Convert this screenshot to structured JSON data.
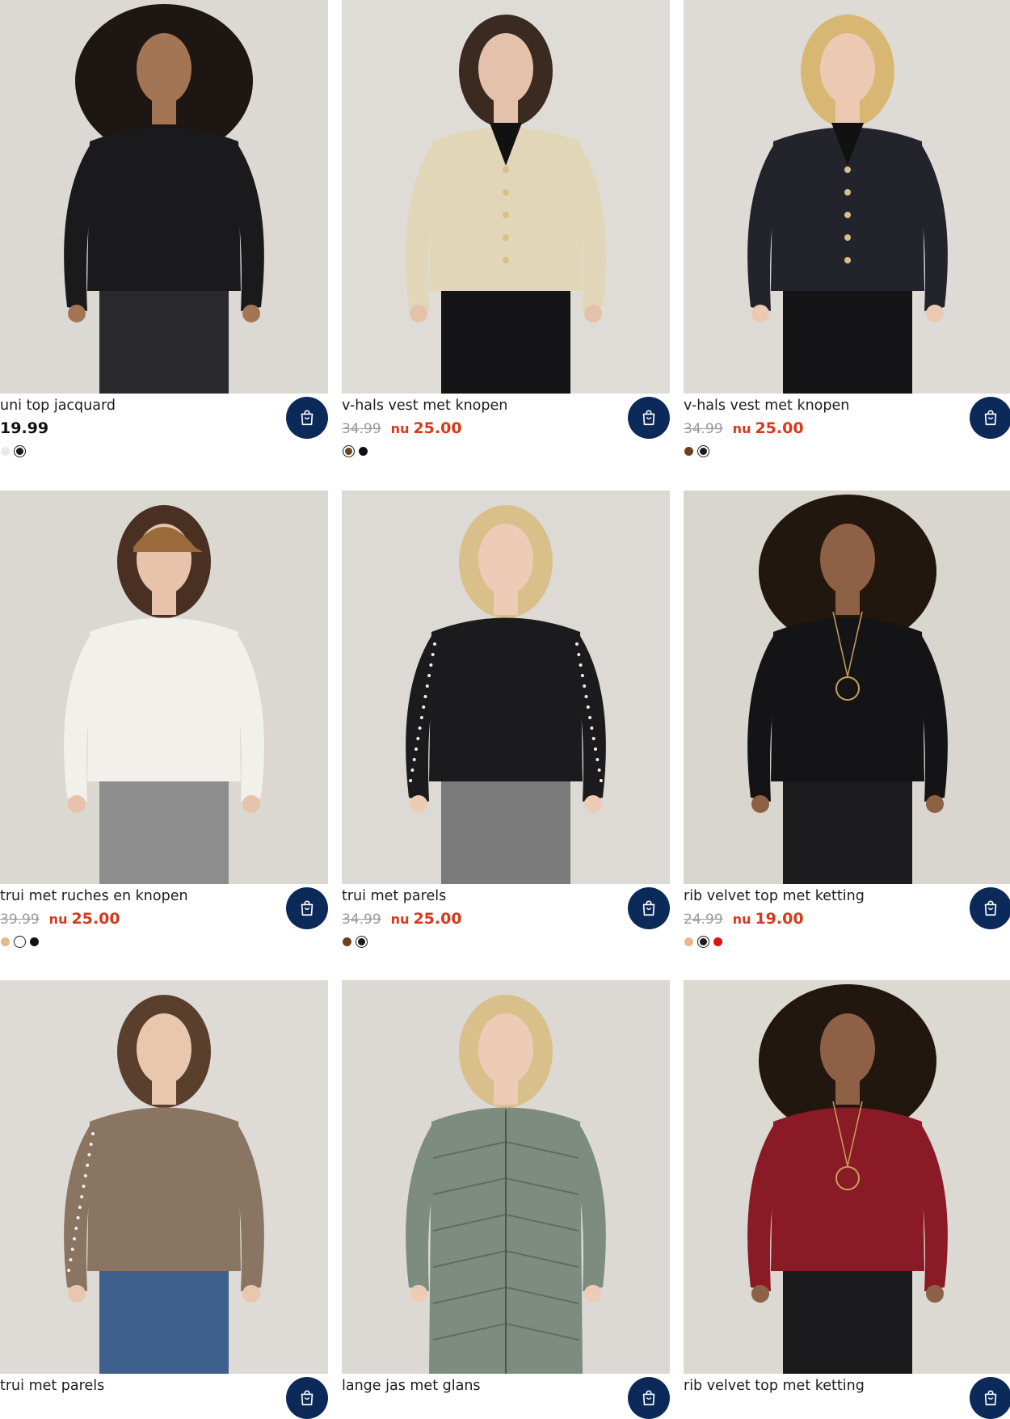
{
  "products": [
    {
      "name": "uni top jacquard",
      "price": "19.99",
      "old_price": "",
      "now_label": "",
      "new_price": "",
      "image": "model-in-black-top-photo",
      "bg": "#dcd9d4",
      "top": "#1a1a1c",
      "bottom": "#2a2a2e",
      "hair": "#1e1612",
      "skin": "#a47555",
      "swatches": [
        {
          "color": "#e8e8f0",
          "selected": false
        },
        {
          "color": "#1a1a1a",
          "selected": true
        }
      ]
    },
    {
      "name": "v-hals vest met knopen",
      "price": "",
      "old_price": "34.99",
      "now_label": "nu",
      "new_price": "25.00",
      "image": "model-in-beige-cardigan-photo",
      "bg": "#dfdcd7",
      "top": "#e2d6b9",
      "bottom": "#141416",
      "hair": "#3a2a20",
      "skin": "#e3c1aa",
      "swatches": [
        {
          "color": "#6b4020",
          "selected": true
        },
        {
          "color": "#111111",
          "selected": false
        }
      ]
    },
    {
      "name": "v-hals vest met knopen",
      "price": "",
      "old_price": "34.99",
      "now_label": "nu",
      "new_price": "25.00",
      "image": "model-in-black-cardigan-photo",
      "bg": "#dedbd6",
      "top": "#23232b",
      "bottom": "#141416",
      "hair": "#d8b772",
      "skin": "#ecc9b2",
      "swatches": [
        {
          "color": "#6b4020",
          "selected": false
        },
        {
          "color": "#1a1a1a",
          "selected": true
        }
      ]
    },
    {
      "name": "trui met ruches en knopen",
      "price": "",
      "old_price": "39.99",
      "now_label": "nu",
      "new_price": "25.00",
      "image": "model-in-white-ruffle-sweater-photo",
      "bg": "#dbd8d2",
      "top": "#f2f0ea",
      "bottom": "#8e8e8e",
      "hair": "#4a3022",
      "skin": "#e6c3aa",
      "swatches": [
        {
          "color": "#e6b88e",
          "selected": false
        },
        {
          "color": "#ffffff",
          "selected": true
        },
        {
          "color": "#111111",
          "selected": false
        }
      ]
    },
    {
      "name": "trui met parels",
      "price": "",
      "old_price": "34.99",
      "now_label": "nu",
      "new_price": "25.00",
      "image": "model-in-black-pearl-sweater-photo",
      "bg": "#dddad5",
      "top": "#1b1b1d",
      "bottom": "#7a7a7a",
      "hair": "#d9c08a",
      "skin": "#ecccb6",
      "swatches": [
        {
          "color": "#6b4020",
          "selected": false
        },
        {
          "color": "#1a1a1a",
          "selected": true
        }
      ]
    },
    {
      "name": "rib velvet top met ketting",
      "price": "",
      "old_price": "24.99",
      "now_label": "nu",
      "new_price": "19.00",
      "image": "model-in-black-velvet-top-photo",
      "bg": "#d9d5cf",
      "top": "#141416",
      "bottom": "#1c1c1e",
      "hair": "#22170f",
      "skin": "#8e6046",
      "swatches": [
        {
          "color": "#e6b88e",
          "selected": false
        },
        {
          "color": "#1a1a1a",
          "selected": true
        },
        {
          "color": "#e01010",
          "selected": false
        }
      ]
    },
    {
      "name": "trui met parels",
      "price": "",
      "old_price": "",
      "now_label": "",
      "new_price": "",
      "image": "model-in-brown-pearl-sweater-photo",
      "bg": "#dedbd6",
      "top": "#8a7462",
      "bottom": "#3f5f8c",
      "hair": "#5a3f2c",
      "skin": "#e8c7ae",
      "swatches": []
    },
    {
      "name": "lange jas met glans",
      "price": "",
      "old_price": "",
      "now_label": "",
      "new_price": "",
      "image": "model-in-green-puffer-coat-photo",
      "bg": "#dcd9d4",
      "top": "#7e8c80",
      "bottom": "#2b3a55",
      "hair": "#d9c08a",
      "skin": "#ecccb6",
      "swatches": []
    },
    {
      "name": "rib velvet top met ketting",
      "price": "",
      "old_price": "",
      "now_label": "",
      "new_price": "",
      "image": "model-in-red-velvet-top-photo",
      "bg": "#dcd8d2",
      "top": "#8a1a26",
      "bottom": "#1a1a1c",
      "hair": "#22170f",
      "skin": "#8e6046",
      "swatches": []
    }
  ],
  "cart_icon": "shopping-bag-icon",
  "cart_color": "#0b2a59"
}
